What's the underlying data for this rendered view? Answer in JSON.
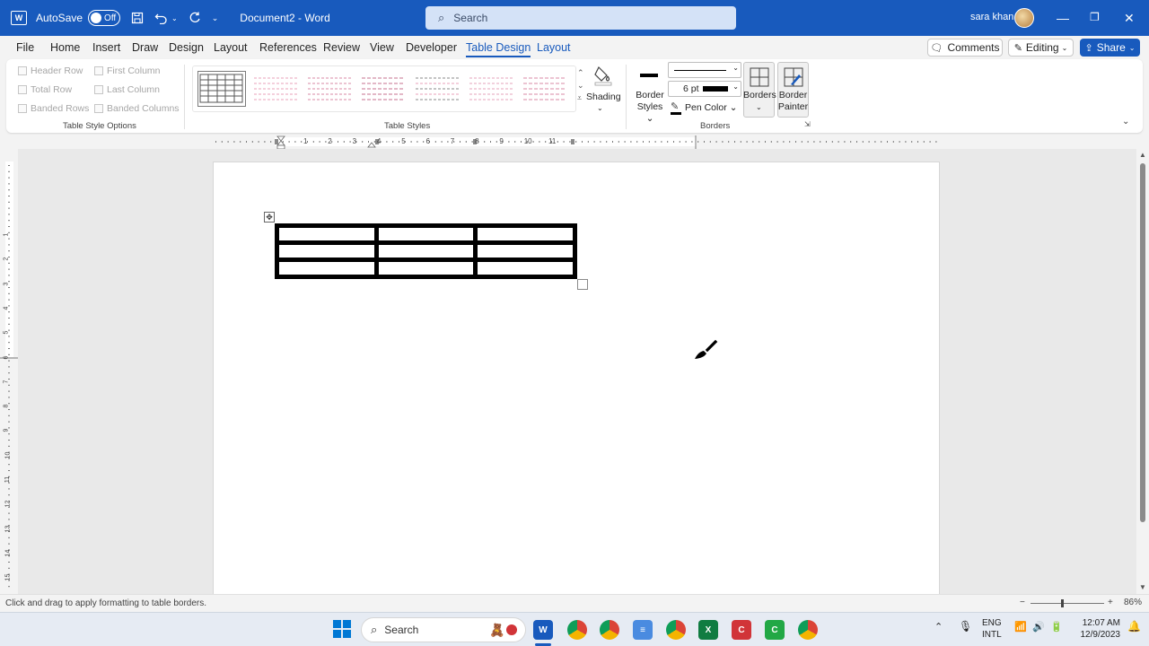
{
  "titlebar": {
    "autosave_label": "AutoSave",
    "autosave_state": "Off",
    "document_title": "Document2",
    "separator": "-",
    "app_name": "Word",
    "search_placeholder": "Search",
    "user_name": "sara khan"
  },
  "menu": {
    "tabs": [
      "File",
      "Home",
      "Insert",
      "Draw",
      "Design",
      "Layout",
      "References",
      "Review",
      "View",
      "Developer",
      "Table Design",
      "Layout"
    ],
    "active_tab": "Table Design",
    "comments_label": "Comments",
    "editing_label": "Editing",
    "share_label": "Share"
  },
  "ribbon": {
    "table_style_options": {
      "items": [
        "Header Row",
        "First Column",
        "Total Row",
        "Last Column",
        "Banded Rows",
        "Banded Columns"
      ],
      "group_label": "Table Style Options"
    },
    "table_styles": {
      "group_label": "Table Styles",
      "shading_label": "Shading"
    },
    "borders": {
      "border_styles_label_1": "Border",
      "border_styles_label_2": "Styles",
      "pen_weight": "6 pt",
      "pen_color_label": "Pen Color",
      "borders_label": "Borders",
      "border_painter_label_1": "Border",
      "border_painter_label_2": "Painter",
      "group_label": "Borders"
    }
  },
  "ruler_numbers": [
    "1",
    "2",
    "3",
    "4",
    "5",
    "6",
    "7",
    "8",
    "9",
    "10",
    "11"
  ],
  "vruler_numbers": [
    "1",
    "2",
    "3",
    "4",
    "5",
    "6",
    "7",
    "8",
    "9",
    "10",
    "11",
    "12",
    "13",
    "14",
    "15"
  ],
  "document": {
    "table": {
      "rows": 3,
      "cols": 3
    }
  },
  "statusbar": {
    "hint": "Click and drag to apply formatting to table borders.",
    "zoom_minus": "−",
    "zoom_plus": "+",
    "zoom_level": "86%"
  },
  "taskbar": {
    "search_label": "Search",
    "lang_1": "ENG",
    "lang_2": "INTL",
    "time": "12:07 AM",
    "date": "12/9/2023"
  },
  "colors": {
    "word_blue": "#185abd",
    "excel_green": "#107c41",
    "accent_red": "#d13438"
  }
}
